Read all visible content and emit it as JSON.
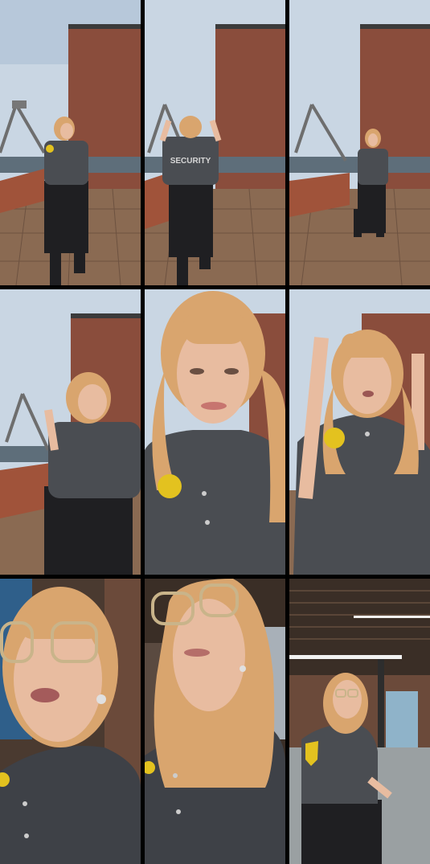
{
  "grid": {
    "rows": 3,
    "columns": 3
  },
  "frames": [
    {
      "scene": "rooftop-deck",
      "badge_text": ""
    },
    {
      "scene": "rooftop-deck-back-view",
      "badge_text": "SECURITY"
    },
    {
      "scene": "rooftop-deck"
    },
    {
      "scene": "rooftop-deck-closeup"
    },
    {
      "scene": "rooftop-closeup"
    },
    {
      "scene": "rooftop-closeup"
    },
    {
      "scene": "indoor-closeup"
    },
    {
      "scene": "indoor-closeup"
    },
    {
      "scene": "indoor-lobby"
    }
  ],
  "colors": {
    "sky": "#c9d6e3",
    "brick": "#8a4d3c",
    "deck": "#8a6a52",
    "shirt": "#4a4d52",
    "pants": "#1f1f22",
    "hair": "#d9a56e",
    "skin": "#e8bca0",
    "badge": "#e3c21f",
    "indoor_ceiling": "#4a3a30",
    "indoor_wall": "#6b4a3a",
    "carpet": "#9aa0a2"
  }
}
